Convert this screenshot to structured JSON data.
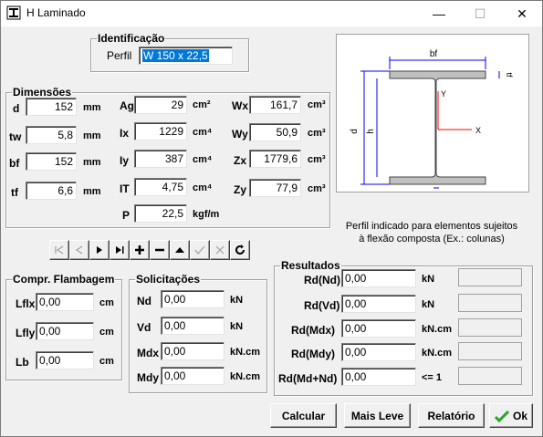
{
  "window": {
    "title": "H Laminado",
    "minimize": "—",
    "maximize": "☐",
    "close": "✕"
  },
  "identificacao": {
    "legend": "Identificação",
    "perfil_label": "Perfil",
    "perfil_value": "W 150 x 22,5"
  },
  "dimensoes": {
    "legend": "Dimensões",
    "d": {
      "label": "d",
      "value": "152",
      "unit": "mm"
    },
    "tw": {
      "label": "tw",
      "value": "5,8",
      "unit": "mm"
    },
    "bf": {
      "label": "bf",
      "value": "152",
      "unit": "mm"
    },
    "tf": {
      "label": "tf",
      "value": "6,6",
      "unit": "mm"
    },
    "Ag": {
      "label": "Ag",
      "value": "29",
      "unit": "cm²"
    },
    "Ix": {
      "label": "Ix",
      "value": "1229",
      "unit": "cm⁴"
    },
    "Iy": {
      "label": "Iy",
      "value": "387",
      "unit": "cm⁴"
    },
    "IT": {
      "label": "IT",
      "value": "4,75",
      "unit": "cm⁴"
    },
    "P": {
      "label": "P",
      "value": "22,5",
      "unit": "kgf/m"
    },
    "Wx": {
      "label": "Wx",
      "value": "161,7",
      "unit": "cm³"
    },
    "Wy": {
      "label": "Wy",
      "value": "50,9",
      "unit": "cm³"
    },
    "Zx": {
      "label": "Zx",
      "value": "1779,6",
      "unit": "cm³"
    },
    "Zy": {
      "label": "Zy",
      "value": "77,9",
      "unit": "cm³"
    }
  },
  "diagram": {
    "labels": {
      "bf": "bf",
      "tf": "tf",
      "d": "d",
      "h": "h",
      "tw": "tw",
      "x": "X",
      "y": "Y"
    },
    "caption_line1": "Perfil indicado para elementos sujeitos",
    "caption_line2": "à flexão composta (Ex.: colunas)",
    "colors": {
      "profile_fill": "#c0c0c0",
      "dimension": "#0000ff",
      "axis": "#ff0000"
    }
  },
  "navigator": {
    "first": "first-icon",
    "prior": "prior-icon",
    "next": "next-icon",
    "last": "last-icon",
    "insert": "plus-icon",
    "delete": "minus-icon",
    "edit": "up-icon",
    "post": "check-icon",
    "cancel": "cross-icon",
    "refresh": "refresh-icon"
  },
  "flambagem": {
    "legend": "Compr. Flambagem",
    "lflx": {
      "label": "Lflx",
      "value": "0,00",
      "unit": "cm"
    },
    "lfly": {
      "label": "Lfly",
      "value": "0,00",
      "unit": "cm"
    },
    "lb": {
      "label": "Lb",
      "value": "0,00",
      "unit": "cm"
    }
  },
  "solicitacoes": {
    "legend": "Solicitações",
    "nd": {
      "label": "Nd",
      "value": "0,00",
      "unit": "kN"
    },
    "vd": {
      "label": "Vd",
      "value": "0,00",
      "unit": "kN"
    },
    "mdx": {
      "label": "Mdx",
      "value": "0,00",
      "unit": "kN.cm"
    },
    "mdy": {
      "label": "Mdy",
      "value": "0,00",
      "unit": "kN.cm"
    }
  },
  "resultados": {
    "legend": "Resultados",
    "rows": [
      {
        "label": "Rd(Nd)",
        "value": "0,00",
        "unit": "kN",
        "extra": ""
      },
      {
        "label": "Rd(Vd)",
        "value": "0,00",
        "unit": "kN",
        "extra": ""
      },
      {
        "label": "Rd(Mdx)",
        "value": "0,00",
        "unit": "kN.cm",
        "extra": ""
      },
      {
        "label": "Rd(Mdy)",
        "value": "0,00",
        "unit": "kN.cm",
        "extra": ""
      },
      {
        "label": "Rd(Md+Nd)",
        "value": "0,00",
        "unit": "<= 1",
        "extra": ""
      }
    ]
  },
  "buttons": {
    "calcular": "Calcular",
    "mais_leve": "Mais Leve",
    "relatorio": "Relatório",
    "ok": "Ok"
  }
}
